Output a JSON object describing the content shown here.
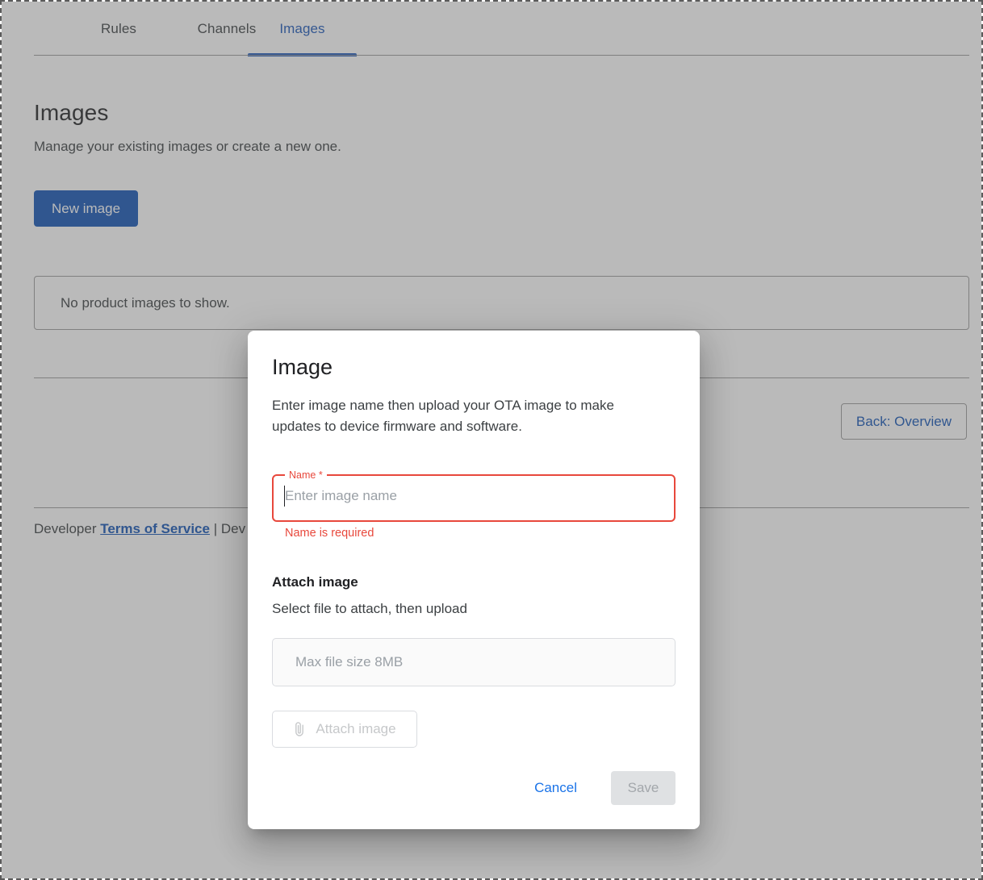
{
  "tabs": [
    {
      "label": "Rules",
      "active": false
    },
    {
      "label": "Channels",
      "active": false
    },
    {
      "label": "Images",
      "active": true
    }
  ],
  "page": {
    "title": "Images",
    "subtitle": "Manage your existing images or create a new one.",
    "new_image_button": "New image",
    "empty_state": "No product images to show.",
    "back_button": "Back: Overview"
  },
  "footer": {
    "prefix": "Developer ",
    "link": "Terms of Service",
    "suffix": " | Dev"
  },
  "modal": {
    "title": "Image",
    "description": "Enter image name then upload your OTA image to make updates to device firmware and software.",
    "name_field": {
      "label": "Name *",
      "value": "",
      "placeholder": "Enter image name",
      "error": "Name is required"
    },
    "attach": {
      "heading": "Attach image",
      "subheading": "Select file to attach, then upload",
      "dropzone_placeholder": "Max file size 8MB",
      "button_label": "Attach image",
      "button_icon": "paperclip-icon"
    },
    "cancel_label": "Cancel",
    "save_label": "Save"
  },
  "colors": {
    "accent_blue": "#1254b5",
    "link_blue": "#1a73e8",
    "error_red": "#e8483c",
    "disabled_gray": "#dfe1e3"
  }
}
